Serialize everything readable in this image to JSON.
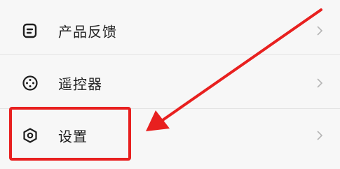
{
  "menu": {
    "items": [
      {
        "label": "产品反馈",
        "icon": "feedback-icon"
      },
      {
        "label": "遥控器",
        "icon": "remote-control-icon"
      },
      {
        "label": "设置",
        "icon": "settings-hexagon-icon"
      }
    ]
  },
  "annotation": {
    "highlight_color": "#e8201f",
    "arrow_color": "#e8201f",
    "target": "设置"
  },
  "colors": {
    "background": "#f7f7f7",
    "text": "#1f1f1f",
    "chevron": "#b5b5b5"
  }
}
